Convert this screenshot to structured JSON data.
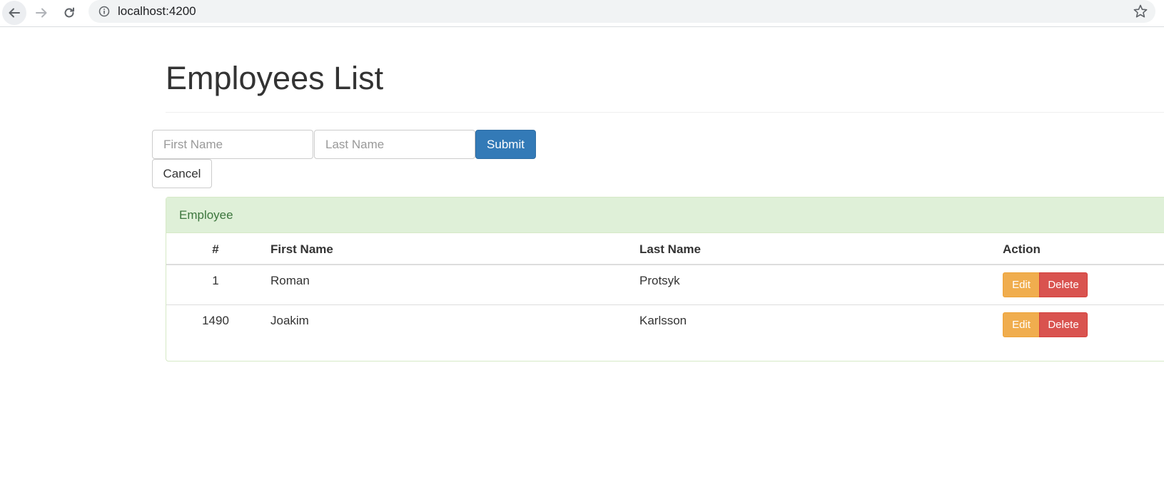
{
  "browser": {
    "url": "localhost:4200",
    "icons": {
      "back": "arrow-left-icon",
      "forward": "arrow-right-icon",
      "reload": "reload-icon",
      "info": "info-icon",
      "bookmark": "star-icon"
    }
  },
  "page": {
    "title": "Employees List"
  },
  "form": {
    "first_name_placeholder": "First Name",
    "last_name_placeholder": "Last Name",
    "submit_label": "Submit",
    "cancel_label": "Cancel"
  },
  "panel": {
    "heading": "Employee",
    "columns": [
      "#",
      "First Name",
      "Last Name",
      "Action"
    ],
    "rows": [
      {
        "id": "1",
        "first_name": "Roman",
        "last_name": "Protsyk",
        "edit_label": "Edit",
        "delete_label": "Delete"
      },
      {
        "id": "1490",
        "first_name": "Joakim",
        "last_name": "Karlsson",
        "edit_label": "Edit",
        "delete_label": "Delete"
      }
    ]
  },
  "colors": {
    "primary": "#337ab7",
    "warning": "#f0ad4e",
    "danger": "#d9534f",
    "success_bg": "#dff0d8",
    "success_text": "#3c763d"
  }
}
